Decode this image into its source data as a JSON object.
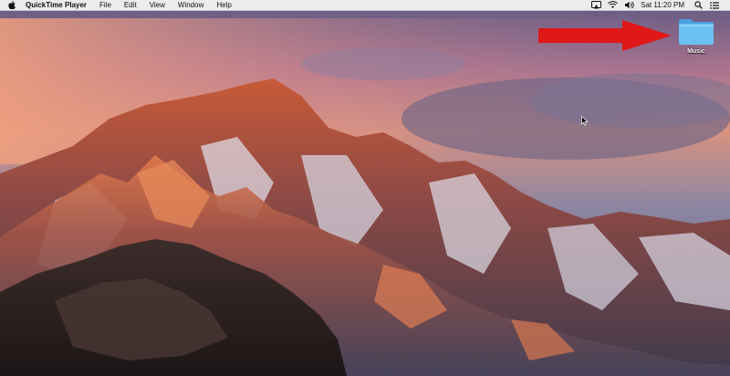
{
  "menubar": {
    "apple_icon": "apple-logo-icon",
    "app_name": "QuickTime Player",
    "menus": [
      "File",
      "Edit",
      "View",
      "Window",
      "Help"
    ],
    "status_icons": [
      "display-mirroring-icon",
      "wifi-icon",
      "volume-icon"
    ],
    "clock": "Sat 11:20 PM",
    "right_icons": [
      "spotlight-search-icon",
      "notification-center-icon"
    ]
  },
  "desktop": {
    "folder": {
      "label": "Music",
      "icon": "folder-icon",
      "color": "#5fb6ee"
    },
    "annotation": {
      "icon": "red-arrow-icon",
      "color": "#e01818"
    },
    "cursor_icon": "mouse-pointer-icon"
  }
}
